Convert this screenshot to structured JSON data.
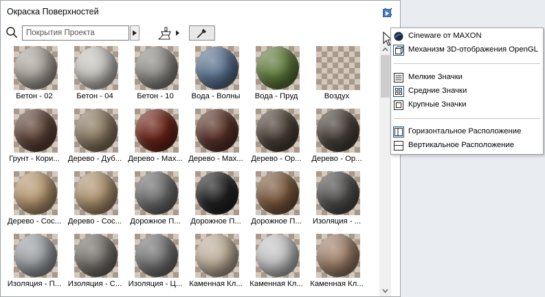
{
  "window": {
    "title": "Окраска Поверхностей"
  },
  "search": {
    "value": "Покрытия Проекта"
  },
  "icons": {
    "search": "search-icon",
    "brush": "paint-brush-icon",
    "eyedropper": "eyedropper-icon",
    "close": "close-icon"
  },
  "materials": [
    {
      "name": "Бетон - 02",
      "color": "#a9a39b"
    },
    {
      "name": "Бетон - 04",
      "color": "#c4c2bc"
    },
    {
      "name": "Бетон - 10",
      "color": "#8e8c88"
    },
    {
      "name": "Вода - Волны",
      "color": "#5b7390"
    },
    {
      "name": "Вода - Пруд",
      "color": "#5f7a3c"
    },
    {
      "name": "Воздух",
      "color": "transparent"
    },
    {
      "name": "Грунт - Кори...",
      "color": "#5e4438"
    },
    {
      "name": "Дерево - Дуб...",
      "color": "#8a7a62"
    },
    {
      "name": "Дерево - Мах...",
      "color": "#6b2518"
    },
    {
      "name": "Дерево - Мах...",
      "color": "#5a3428"
    },
    {
      "name": "Дерево - Ор...",
      "color": "#4c4137"
    },
    {
      "name": "Дерево - Ор...",
      "color": "#4a4039"
    },
    {
      "name": "Дерево - Сос...",
      "color": "#b5966e"
    },
    {
      "name": "Дерево - Сос...",
      "color": "#ad9270"
    },
    {
      "name": "Дорожное П...",
      "color": "#6d6d6d"
    },
    {
      "name": "Дорожное П...",
      "color": "#232323"
    },
    {
      "name": "Дорожное П...",
      "color": "#7c5a3e"
    },
    {
      "name": "Изоляция - ...",
      "color": "#4f4e4c"
    },
    {
      "name": "Изоляция - П...",
      "color": "#9a9ea2"
    },
    {
      "name": "Изоляция - С...",
      "color": "#75716b"
    },
    {
      "name": "Изоляция - Ц...",
      "color": "#747474"
    },
    {
      "name": "Каменная Кл...",
      "color": "#bcae98"
    },
    {
      "name": "Каменная Кл...",
      "color": "#c3c3c3"
    },
    {
      "name": "Каменная Кл...",
      "color": "#9e7f6a"
    }
  ],
  "menu": {
    "items": [
      {
        "label": "Cineware от MAXON",
        "icon": "cineware-icon"
      },
      {
        "label": "Механизм 3D-отображения OpenGL",
        "icon": "opengl-icon"
      },
      {
        "label": "Мелкие Значки",
        "icon": "small-icons-icon"
      },
      {
        "label": "Средние Значки",
        "icon": "medium-icons-icon"
      },
      {
        "label": "Крупные Значки",
        "icon": "large-icons-icon"
      },
      {
        "label": "Горизонтальное Расположение",
        "icon": "horizontal-layout-icon"
      },
      {
        "label": "Вертикальное Расположение",
        "icon": "vertical-layout-icon"
      }
    ]
  }
}
